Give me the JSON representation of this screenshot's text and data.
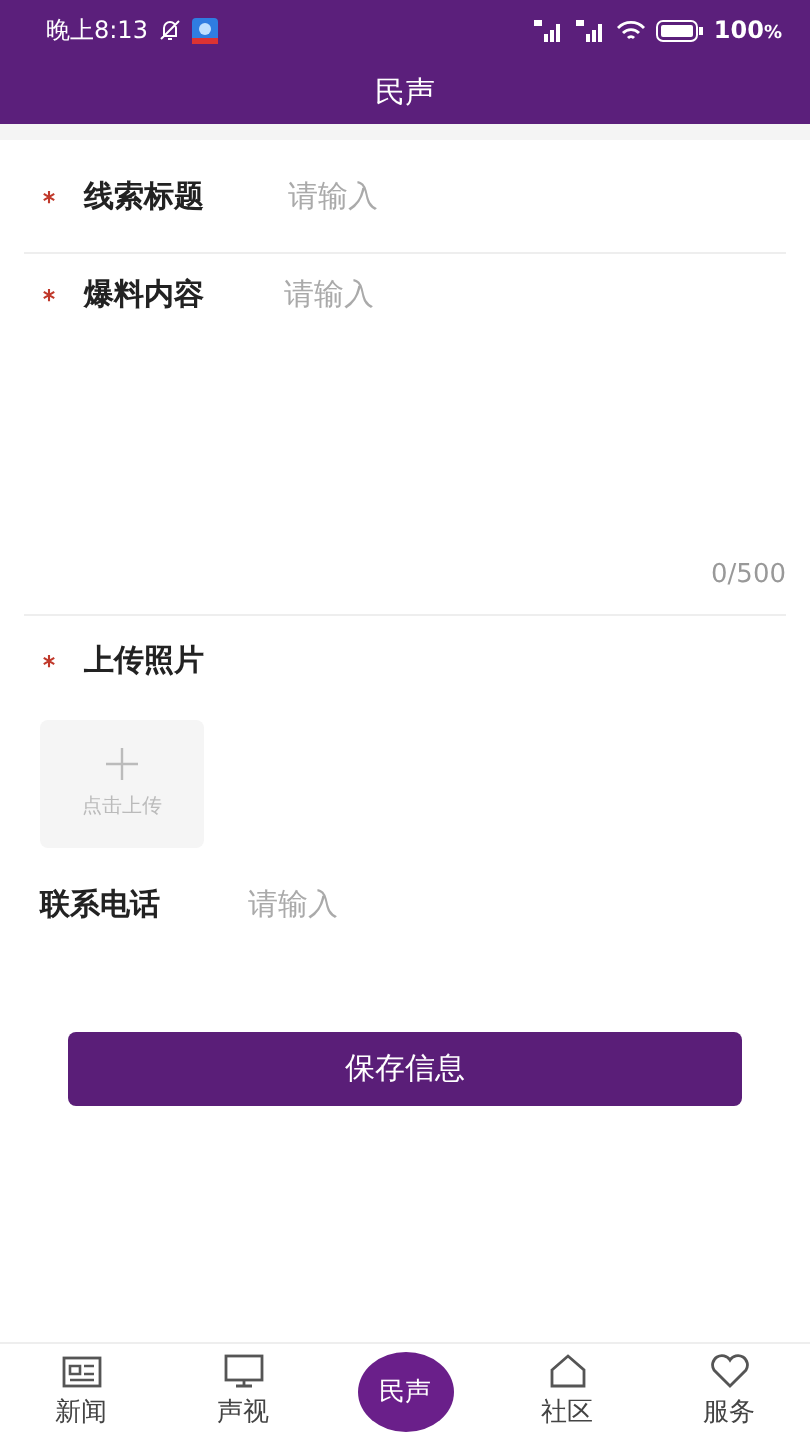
{
  "status_bar": {
    "time": "晚上8:13",
    "battery": "100",
    "battery_unit": "%"
  },
  "header": {
    "title": "民声"
  },
  "form": {
    "fields": [
      {
        "kind": "input",
        "required": true,
        "label": "线索标题",
        "placeholder": "请输入"
      },
      {
        "kind": "textarea",
        "required": true,
        "label": "爆料内容",
        "placeholder": "请输入",
        "counter": "0/500"
      },
      {
        "kind": "upload",
        "required": true,
        "label": "上传照片",
        "upload_label": "点击上传"
      },
      {
        "kind": "input",
        "required": false,
        "label": "联系电话",
        "placeholder": "请输入"
      }
    ],
    "save_button": "保存信息"
  },
  "tab_bar": [
    {
      "kind": "news",
      "label": "新闻",
      "selected": false
    },
    {
      "kind": "tv",
      "label": "声视",
      "selected": false
    },
    {
      "kind": "center",
      "label": "民声",
      "selected": true
    },
    {
      "kind": "home",
      "label": "社区",
      "selected": false
    },
    {
      "kind": "heart",
      "label": "服务",
      "selected": false
    }
  ]
}
